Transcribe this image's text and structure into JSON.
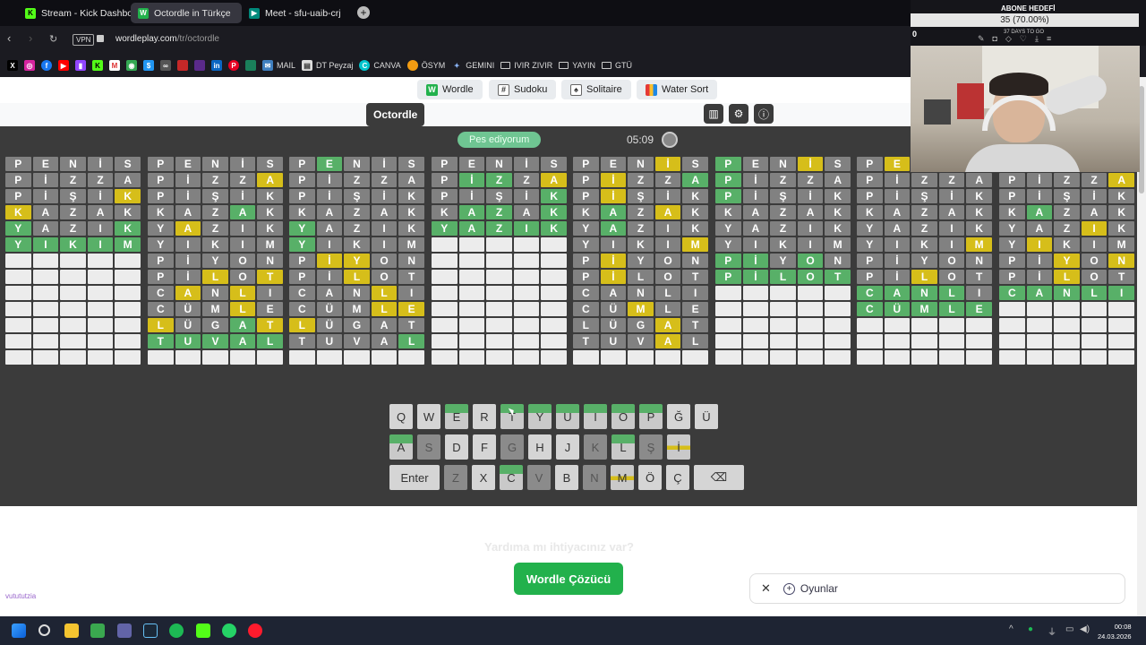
{
  "browser": {
    "tabs": [
      {
        "label": "Stream - Kick Dashboard",
        "icon": "kick-icon",
        "color": "#53fc18"
      },
      {
        "label": "Octordle in Türkçe",
        "icon": "wordle-icon",
        "color": "#22b14c"
      },
      {
        "label": "Meet - sfu-uaib-crj",
        "icon": "meet-icon",
        "color": "#00897b"
      }
    ],
    "vpn_label": "VPN",
    "url_host": "wordleplay.com",
    "url_path": "/tr/octordle"
  },
  "bookmarks": [
    {
      "label": "MAIL",
      "icon": "mail-icon"
    },
    {
      "label": "DT Peyzaj",
      "icon": "page-icon"
    },
    {
      "label": "CANVA",
      "icon": "canva-icon"
    },
    {
      "label": "ÖSYM",
      "icon": "osym-icon"
    },
    {
      "label": "GEMINI",
      "icon": "gemini-icon"
    },
    {
      "label": "IVIR ZIVIR",
      "icon": "folder-icon"
    },
    {
      "label": "YAYIN",
      "icon": "folder-icon"
    },
    {
      "label": "GTÜ",
      "icon": "folder-icon"
    }
  ],
  "game_nav": [
    {
      "label": "Wordle",
      "icon": "wordle-icon"
    },
    {
      "label": "Sudoku",
      "icon": "sudoku-icon"
    },
    {
      "label": "Solitaire",
      "icon": "solitaire-icon"
    },
    {
      "label": "Water Sort",
      "icon": "water-sort-icon"
    }
  ],
  "game": {
    "title": "Octordle",
    "give_up": "Pes ediyorum",
    "timer": "05:09"
  },
  "boards": [
    [
      "P:x E:x N:x İ:x S:x",
      "P:x İ:x Z:x Z:x A:x",
      "P:x İ:x Ş:x İ:x K:y",
      "K:y A:x Z:x A:x K:x",
      "Y:g A:x Z:x I:x K:g",
      "Y:g I:g K:g I:g M:g",
      "",
      "",
      "",
      "",
      "",
      "",
      ""
    ],
    [
      "P:x E:x N:x İ:x S:x",
      "P:x İ:x Z:x Z:x A:y",
      "P:x İ:x Ş:x İ:x K:x",
      "K:x A:x Z:x A:g K:x",
      "Y:x A:y Z:x I:x K:x",
      "Y:x I:x K:x I:x M:x",
      "P:x İ:x Y:x O:x N:x",
      "P:x İ:x L:y O:x T:y",
      "C:x A:y N:x L:y I:x",
      "C:x Ü:x M:x L:y E:x",
      "L:y Ü:x G:x A:g T:y",
      "T:g U:g V:g A:g L:g",
      ""
    ],
    [
      "P:x E:g N:x İ:x S:x",
      "P:x İ:x Z:x Z:x A:x",
      "P:x İ:x Ş:x İ:x K:x",
      "K:x A:x Z:x A:x K:x",
      "Y:g A:x Z:x I:x K:x",
      "Y:g I:x K:x I:x M:x",
      "P:x İ:y Y:y O:x N:x",
      "P:x İ:x L:y O:x T:x",
      "C:x A:x N:x L:y I:x",
      "C:x Ü:x M:x L:y E:y",
      "L:y Ü:x G:x A:x T:x",
      "T:x U:x V:x A:x L:g",
      ""
    ],
    [
      "P:x E:x N:x İ:x S:x",
      "P:x İ:g Z:g Z:x A:y",
      "P:x İ:x Ş:x İ:x K:g",
      "K:x A:g Z:g A:x K:g",
      "Y:g A:g Z:g I:g K:g",
      "",
      "",
      "",
      "",
      "",
      "",
      "",
      ""
    ],
    [
      "P:x E:x N:x İ:y S:x",
      "P:x İ:y Z:x Z:x A:g",
      "P:x İ:y Ş:x İ:x K:x",
      "K:x A:g Z:x A:y K:x",
      "Y:x A:g Z:x I:x K:x",
      "Y:x I:x K:x I:x M:y",
      "P:x İ:y Y:x O:x N:x",
      "P:x İ:y L:x O:x T:x",
      "C:x A:x N:x L:x I:x",
      "C:x Ü:x M:y L:x E:x",
      "L:x Ü:x G:x A:y T:x",
      "T:x U:x V:x A:y L:x",
      ""
    ],
    [
      "P:g E:x N:x İ:y S:x",
      "P:g İ:x Z:x Z:x A:x",
      "P:g İ:x Ş:x İ:x K:x",
      "K:x A:x Z:x A:x K:x",
      "Y:x A:x Z:x I:x K:x",
      "Y:x I:x K:x I:x M:x",
      "P:g İ:g Y:x O:g N:x",
      "P:g İ:g L:g O:g T:g",
      "",
      "",
      "",
      "",
      ""
    ],
    [
      "P:x E:y N:x İ:x S:x",
      "P:x İ:x Z:x Z:x A:x",
      "P:x İ:x Ş:x İ:x K:x",
      "K:x A:x Z:x A:x K:x",
      "Y:x A:x Z:x I:x K:x",
      "Y:x I:x K:x I:x M:y",
      "P:x İ:x Y:x O:x N:x",
      "P:x İ:x L:y O:x T:x",
      "C:g A:g N:g L:g I:x",
      "C:g Ü:g M:g L:g E:g",
      "",
      "",
      ""
    ],
    [
      "P:x E:x N:x İ:x S:x",
      "P:x İ:x Z:x Z:x A:y",
      "P:x İ:x Ş:x İ:x K:x",
      "K:x A:g Z:x A:x K:x",
      "Y:x A:x Z:x I:y K:x",
      "Y:x I:y K:x I:x M:x",
      "P:x İ:x Y:y O:x N:y",
      "P:x İ:x L:y O:x T:x",
      "C:g A:g N:g L:g I:g",
      "",
      "",
      "",
      ""
    ]
  ],
  "keyboard": {
    "row1": [
      "Q",
      "W",
      "E",
      "R",
      "T",
      "Y",
      "U",
      "I",
      "O",
      "P",
      "Ğ",
      "Ü"
    ],
    "row2": [
      "A",
      "S",
      "D",
      "F",
      "G",
      "H",
      "J",
      "K",
      "L",
      "Ş",
      "İ"
    ],
    "row3": [
      "Enter",
      "Z",
      "X",
      "C",
      "V",
      "B",
      "N",
      "M",
      "Ö",
      "Ç",
      "⌫"
    ]
  },
  "bottom": {
    "help_text": "Yardıma mı ihtiyacınız var?",
    "solver_button": "Wordle Çözücü",
    "games_label": "Oyunlar",
    "watermark": "vutututzia"
  },
  "overlay": {
    "title": "ABONE HEDEFİ",
    "progress": "35 (70.00%)",
    "progress_fraction": 0.7,
    "zero": "0",
    "days": "37 DAYS TO GO"
  },
  "taskbar": {
    "time": "00:08",
    "date": "24.03.2026"
  },
  "colors": {
    "green": "#58b068",
    "yellow": "#d6be1a",
    "absent": "#818181",
    "empty": "#ececec",
    "solver": "#22b14c"
  }
}
